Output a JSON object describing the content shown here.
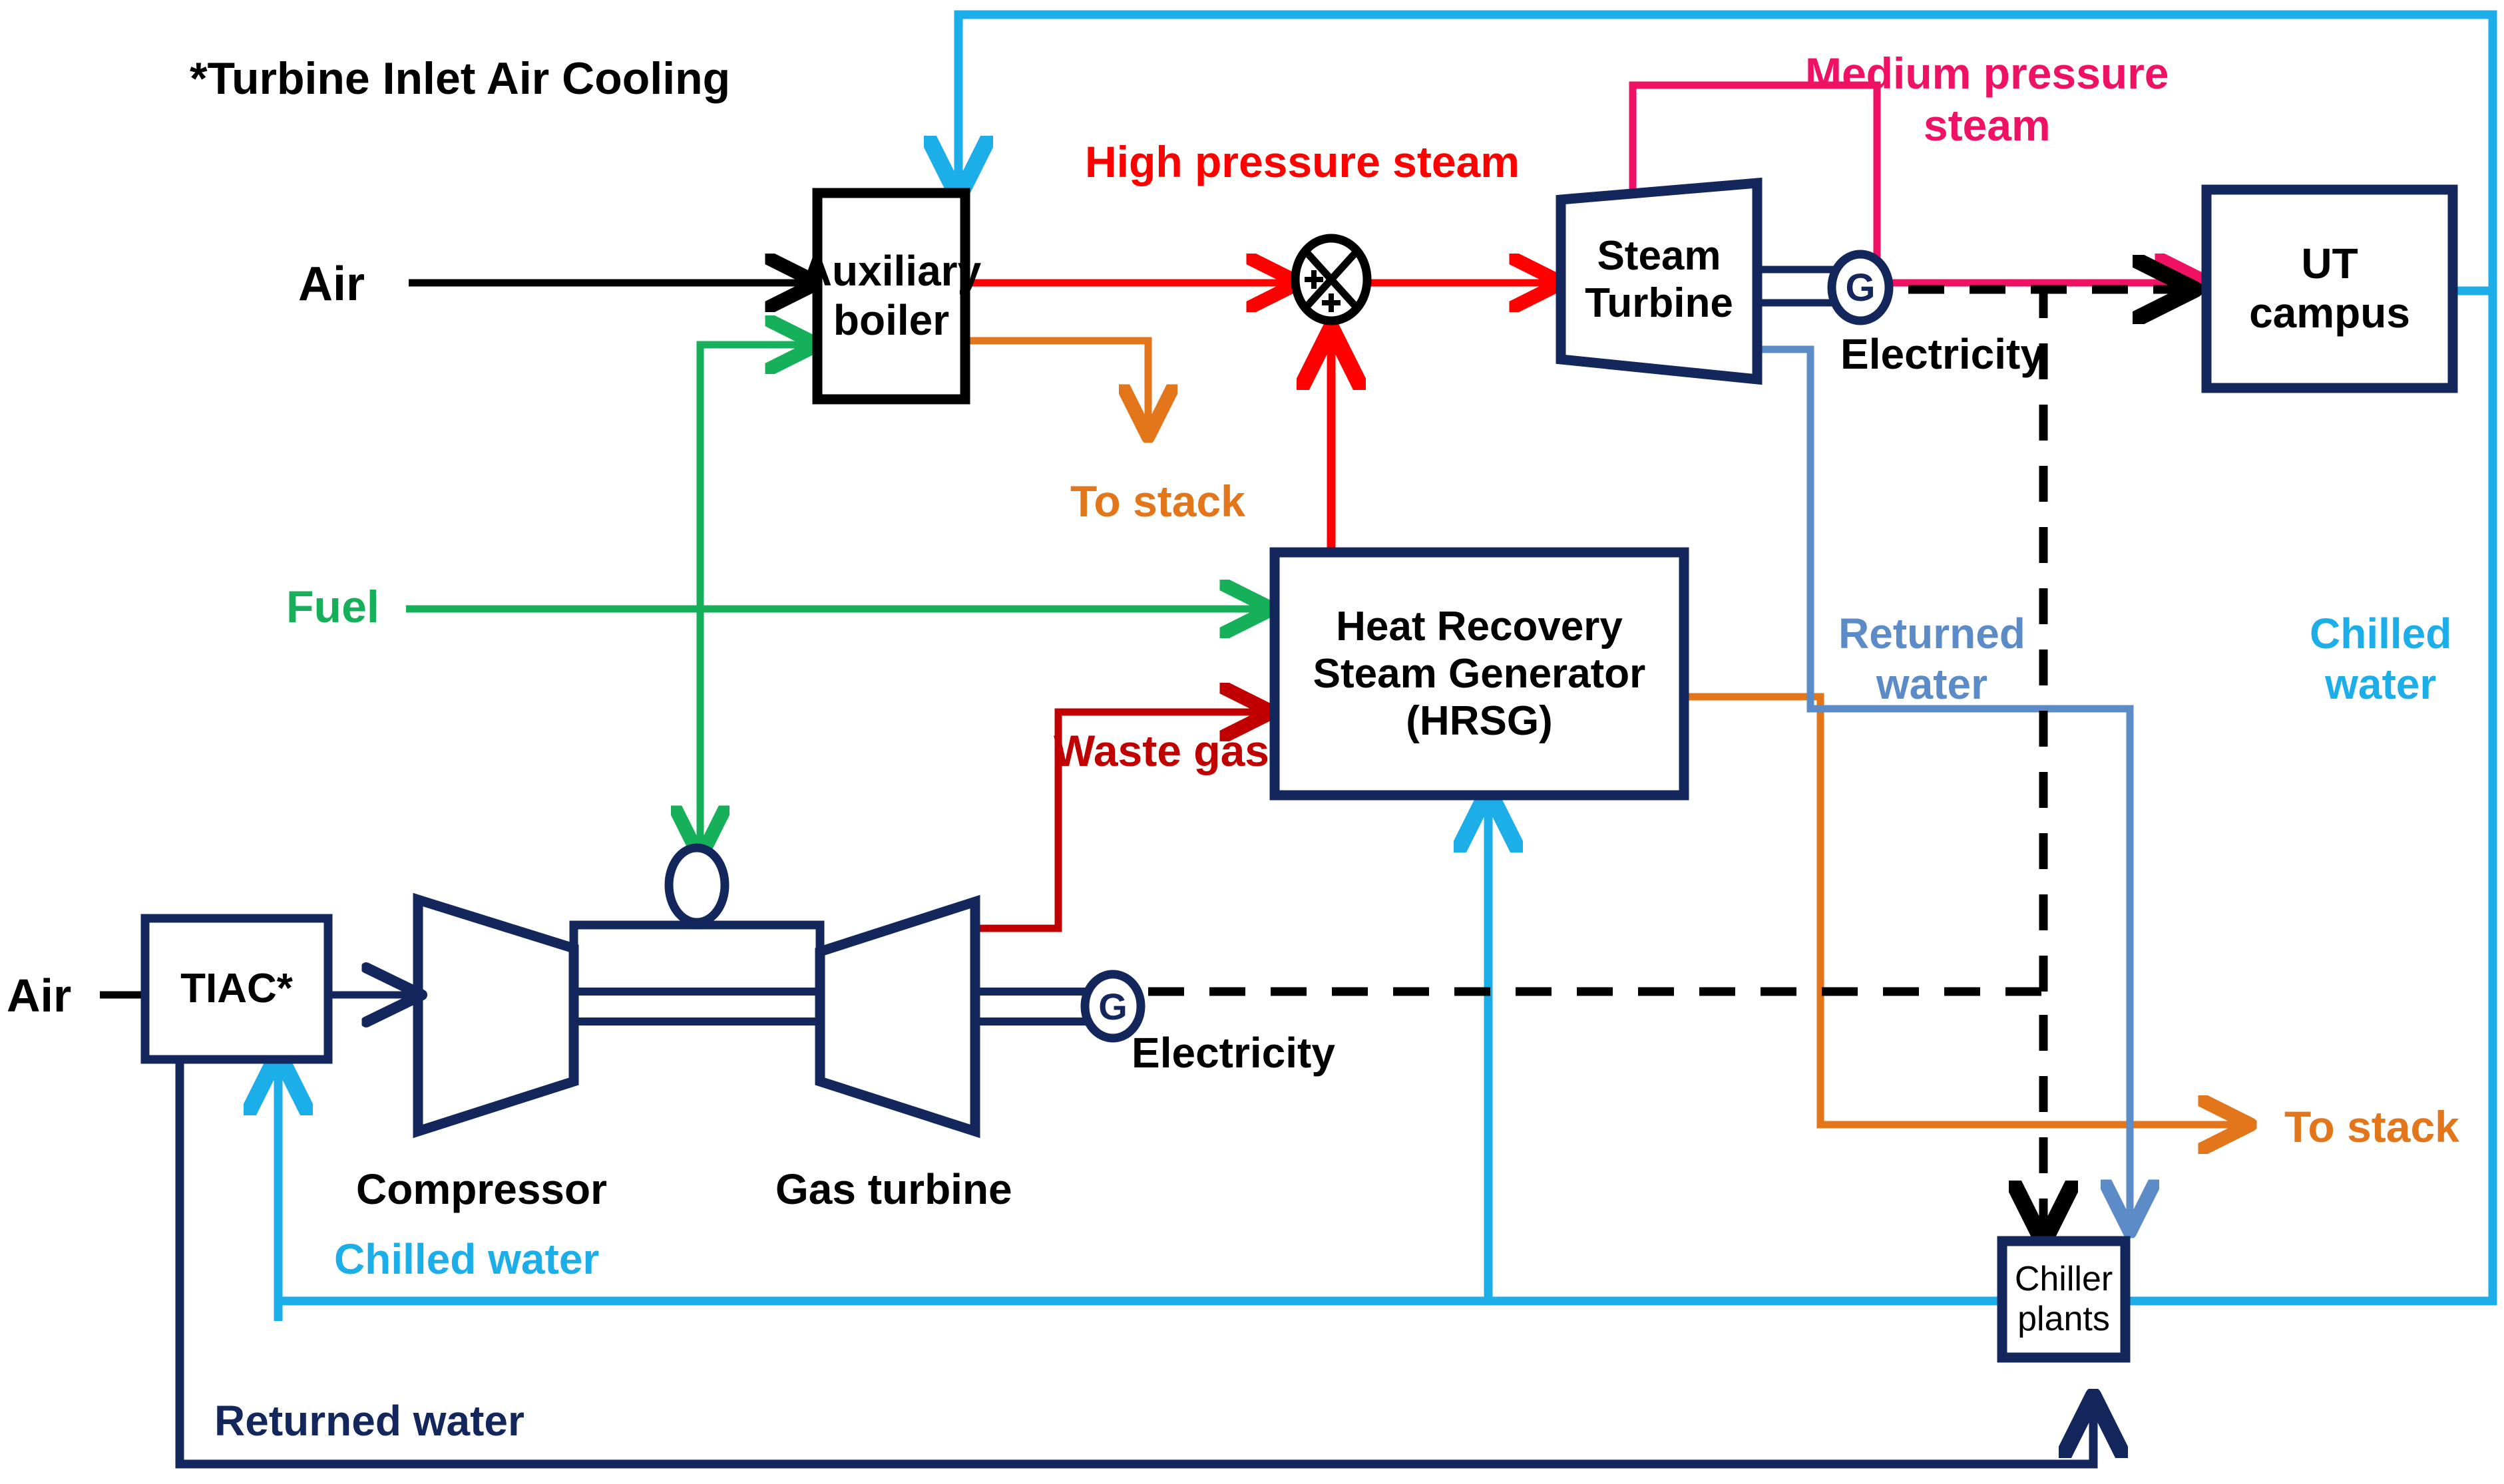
{
  "title_note": "*Turbine Inlet Air Cooling",
  "blocks": {
    "auxiliary_boiler": "Auxiliary\nboiler",
    "steam_turbine": "Steam\nTurbine",
    "ut_campus": "UT\ncampus",
    "hrsg": "Heat Recovery\nSteam Generator\n(HRSG)",
    "tiac": "TIAC*",
    "chiller_plants": "Chiller\nplants",
    "generator_symbol": "G"
  },
  "labels": {
    "air_top": "Air",
    "air_bottom": "Air",
    "fuel": "Fuel",
    "high_pressure_steam": "High pressure steam",
    "medium_pressure_steam": "Medium pressure\nsteam",
    "to_stack_top": "To stack",
    "to_stack_right": "To stack",
    "waste_gas": "Waste gas",
    "electricity_steam": "Electricity",
    "electricity_gas": "Electricity",
    "returned_water_right": "Returned\nwater",
    "returned_water_bottom": "Returned water",
    "chilled_water_right": "Chilled\nwater",
    "chilled_water_bottom": "Chilled water",
    "compressor": "Compressor",
    "gas_turbine": "Gas turbine"
  },
  "colors": {
    "navy": "#13275C",
    "black": "#000000",
    "red": "#FF0000",
    "dark_red": "#C00000",
    "orange": "#E3761A",
    "green": "#16B05A",
    "pink": "#EE1164",
    "cyan": "#1CAEE8",
    "steel_blue": "#5B8CC8"
  },
  "icons": {
    "mixer": "mixer-circle-with-cross-and-plus",
    "generator": "generator-circle-g",
    "combustor": "combustion-chamber-ellipse"
  }
}
